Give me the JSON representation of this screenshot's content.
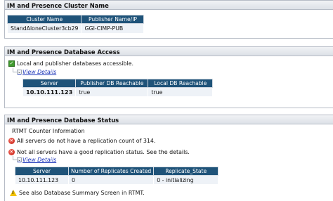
{
  "cluster": {
    "title": "IM and Presence Cluster Name",
    "headers": [
      "Cluster Name",
      "Publisher Name/IP"
    ],
    "row": [
      "StandAloneCluster3cb29",
      "GGI-CIMP-PUB"
    ]
  },
  "db_access": {
    "title": "IM and Presence Database Access",
    "status_text": "Local and publisher databases accessible.",
    "view_details": "View Details",
    "headers": [
      "Server",
      "Publisher DB Reachable",
      "Local DB Reachable"
    ],
    "row": [
      "10.10.111.123",
      "true",
      "true"
    ]
  },
  "db_status": {
    "title": "IM and Presence Database Status",
    "rtmt_label": "RTMT Counter Information",
    "error1": "All servers do not have a replication count of 314.",
    "error2": "Not all servers have a good replication status. See the details.",
    "view_details": "View Details",
    "headers": [
      "Server",
      "Number of Replicates Created",
      "Replicate_State"
    ],
    "row": [
      "10.10.111.123",
      "0",
      "0 - initializing"
    ],
    "warning": "See also Database Summary Screen in RTMT."
  },
  "icons": {
    "ok": "check-icon",
    "error": "error-x-icon",
    "warning": "warning-triangle-icon",
    "expand": "chevron-down-icon"
  },
  "colors": {
    "table_header": "#1f5379",
    "link": "#1a33b8",
    "ok": "#3f9a2c",
    "error": "#c41e13",
    "warning": "#f2c200"
  }
}
